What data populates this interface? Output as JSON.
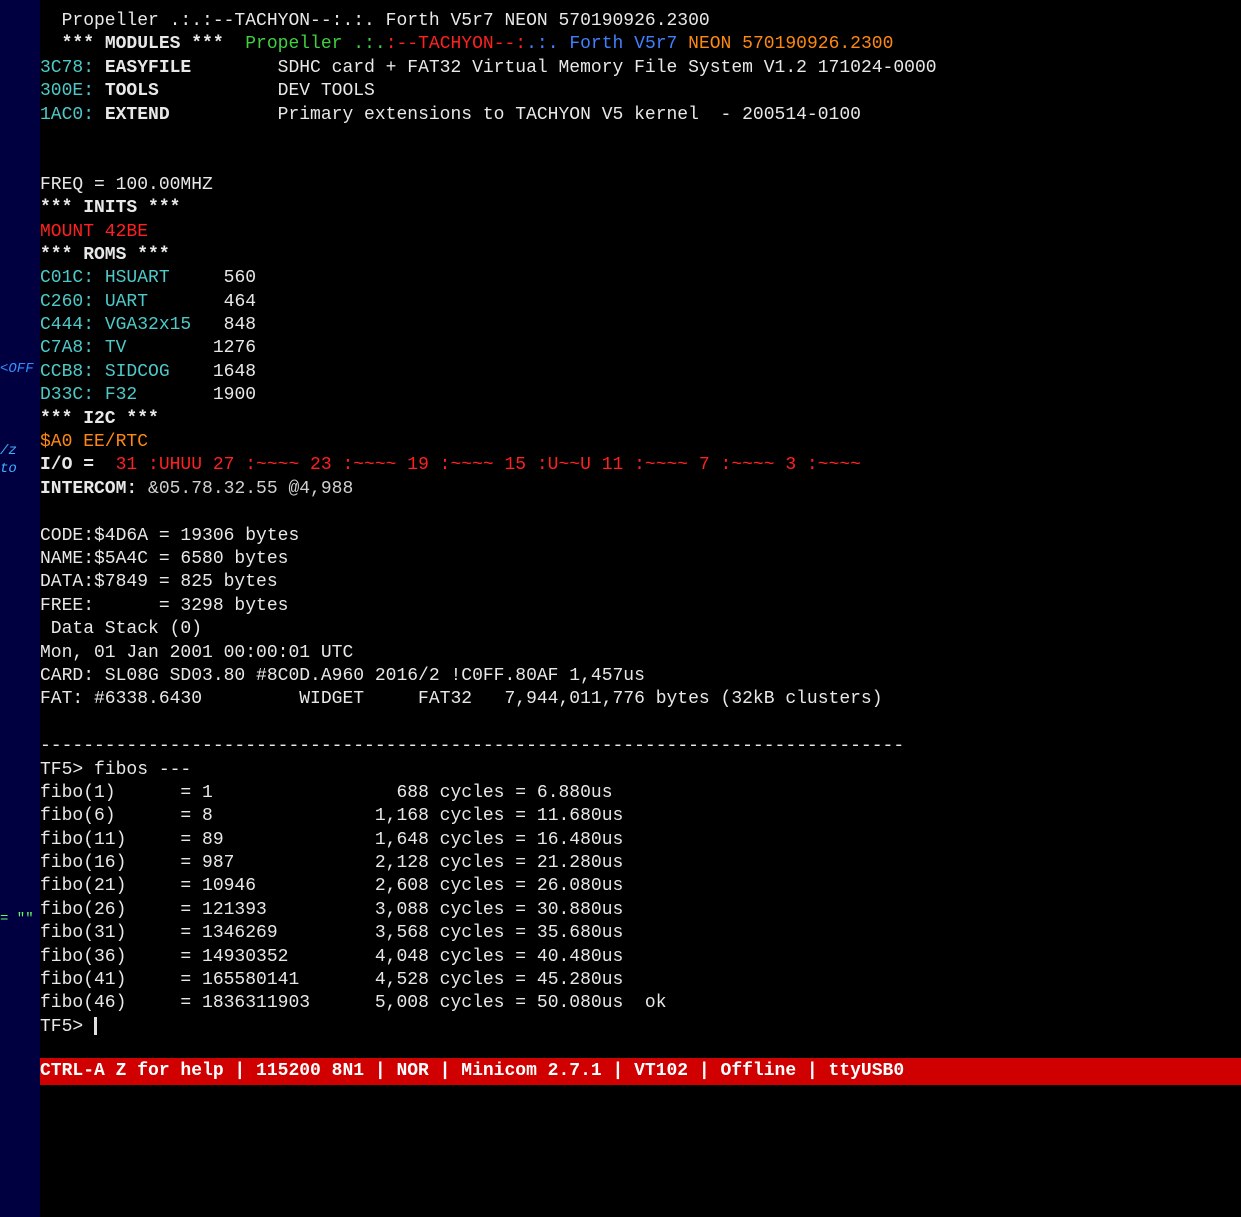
{
  "header": {
    "line1": "  Propeller .:.:--TACHYON--:.:. Forth V5r7 NEON 570190926.2300",
    "modules_label": "*** MODULES ***",
    "line2_green": "Propeller .:.",
    "line2_red": ":--TACHYON--:",
    "line2_blue": ".:. Forth V5r7 ",
    "line2_orange": "NEON 570190926.2300"
  },
  "modules": {
    "easyfile_addr": "3C78: ",
    "easyfile_name": "EASYFILE",
    "easyfile_desc": "        SDHC card + FAT32 Virtual Memory File System V1.2 171024-0000",
    "tools_addr": "300E: ",
    "tools_name": "TOOLS",
    "tools_desc": "           DEV TOOLS",
    "extend_addr": "1AC0: ",
    "extend_name": "EXTEND",
    "extend_desc": "          Primary extensions to TACHYON V5 kernel  - 200514-0100"
  },
  "freq": "FREQ = 100.00MHZ",
  "inits_label": "*** INITS ***",
  "mount": "MOUNT 42BE",
  "roms_label": "*** ROMS ***",
  "roms": [
    {
      "addr": "C01C: ",
      "name": "HSUART    ",
      "size": " 560"
    },
    {
      "addr": "C260: ",
      "name": "UART      ",
      "size": " 464"
    },
    {
      "addr": "C444: ",
      "name": "VGA32x15  ",
      "size": " 848"
    },
    {
      "addr": "C7A8: ",
      "name": "TV        ",
      "size": "1276"
    },
    {
      "addr": "CCB8: ",
      "name": "SIDCOG    ",
      "size": "1648"
    },
    {
      "addr": "D33C: ",
      "name": "F32       ",
      "size": "1900"
    }
  ],
  "i2c_label": "*** I2C ***",
  "i2c_device": "$A0 EE/RTC",
  "io_label": "I/O = ",
  "io_red": " 31 :UHUU 27 :~~~~ 23 :~~~~ 19 :~~~~ 15 :U~~U 11 :~~~~ 7 :~~~~ 3 :~~~~",
  "intercom_label": "INTERCOM: ",
  "intercom_val": "&05.78.32.55 @4,988",
  "memory": {
    "code": "CODE:$4D6A = 19306 bytes",
    "name": "NAME:$5A4C = 6580 bytes",
    "data": "DATA:$7849 = 825 bytes",
    "free": "FREE:      = 3298 bytes"
  },
  "stack": " Data Stack (0)",
  "date": "Mon, 01 Jan 2001 00:00:01 UTC",
  "card": "CARD: SL08G SD03.80 #8C0D.A960 2016/2 !C0FF.80AF 1,457us",
  "fat": "FAT: #6338.6430         WIDGET     FAT32   7,944,011,776 bytes (32kB clusters)",
  "separator": "--------------------------------------------------------------------------------",
  "prompt1": "TF5> fibos ---",
  "fibos": [
    {
      "l": "fibo(1)      = 1              ",
      "r": "   688 cycles = 6.880us"
    },
    {
      "l": "fibo(6)      = 8              ",
      "r": " 1,168 cycles = 11.680us"
    },
    {
      "l": "fibo(11)     = 89             ",
      "r": " 1,648 cycles = 16.480us"
    },
    {
      "l": "fibo(16)     = 987            ",
      "r": " 2,128 cycles = 21.280us"
    },
    {
      "l": "fibo(21)     = 10946          ",
      "r": " 2,608 cycles = 26.080us"
    },
    {
      "l": "fibo(26)     = 121393         ",
      "r": " 3,088 cycles = 30.880us"
    },
    {
      "l": "fibo(31)     = 1346269        ",
      "r": " 3,568 cycles = 35.680us"
    },
    {
      "l": "fibo(36)     = 14930352       ",
      "r": " 4,048 cycles = 40.480us"
    },
    {
      "l": "fibo(41)     = 165580141      ",
      "r": " 4,528 cycles = 45.280us"
    },
    {
      "l": "fibo(46)     = 1836311903     ",
      "r": " 5,008 cycles = 50.080us  ok"
    }
  ],
  "prompt2": "TF5> ",
  "statusbar": "CTRL-A Z for help | 115200 8N1 | NOR | Minicom 2.7.1 | VT102 | Offline | ttyUSB0",
  "margin": {
    "off": "<OFF",
    "tz": "/z to",
    "eq": "=  \"\""
  }
}
